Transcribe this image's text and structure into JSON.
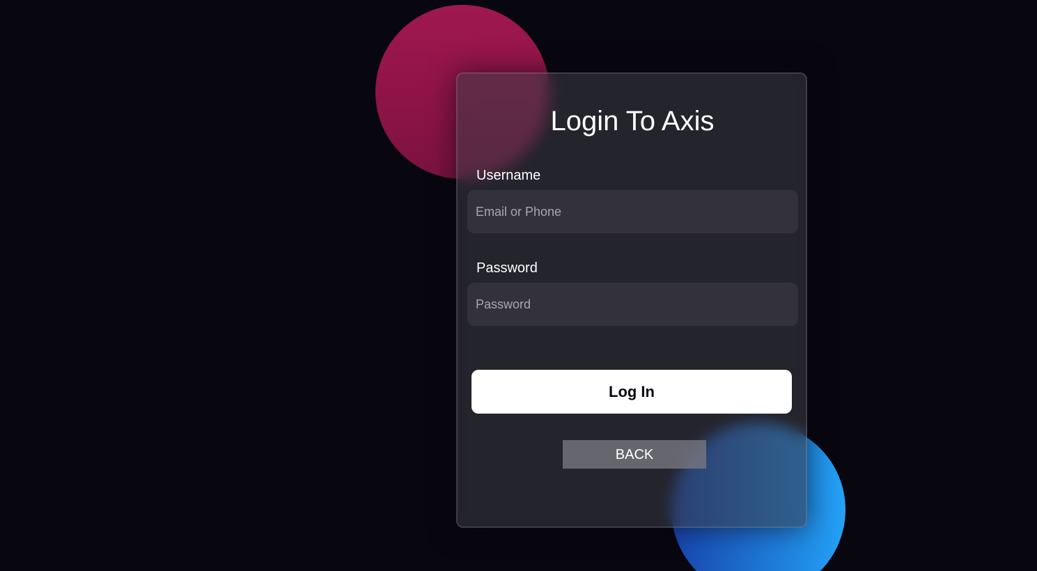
{
  "page": {
    "background_color": "#080710"
  },
  "decor": {
    "pink_circle_color": "#a0184f",
    "blue_circle_gradient": [
      "#1845ad",
      "#23a2f6"
    ]
  },
  "login_form": {
    "title": "Login To Axis",
    "username": {
      "label": "Username",
      "value": "",
      "placeholder": "Email or Phone"
    },
    "password": {
      "label": "Password",
      "value": "",
      "placeholder": "Password"
    },
    "login_button": "Log In",
    "back_button": "BACK"
  }
}
